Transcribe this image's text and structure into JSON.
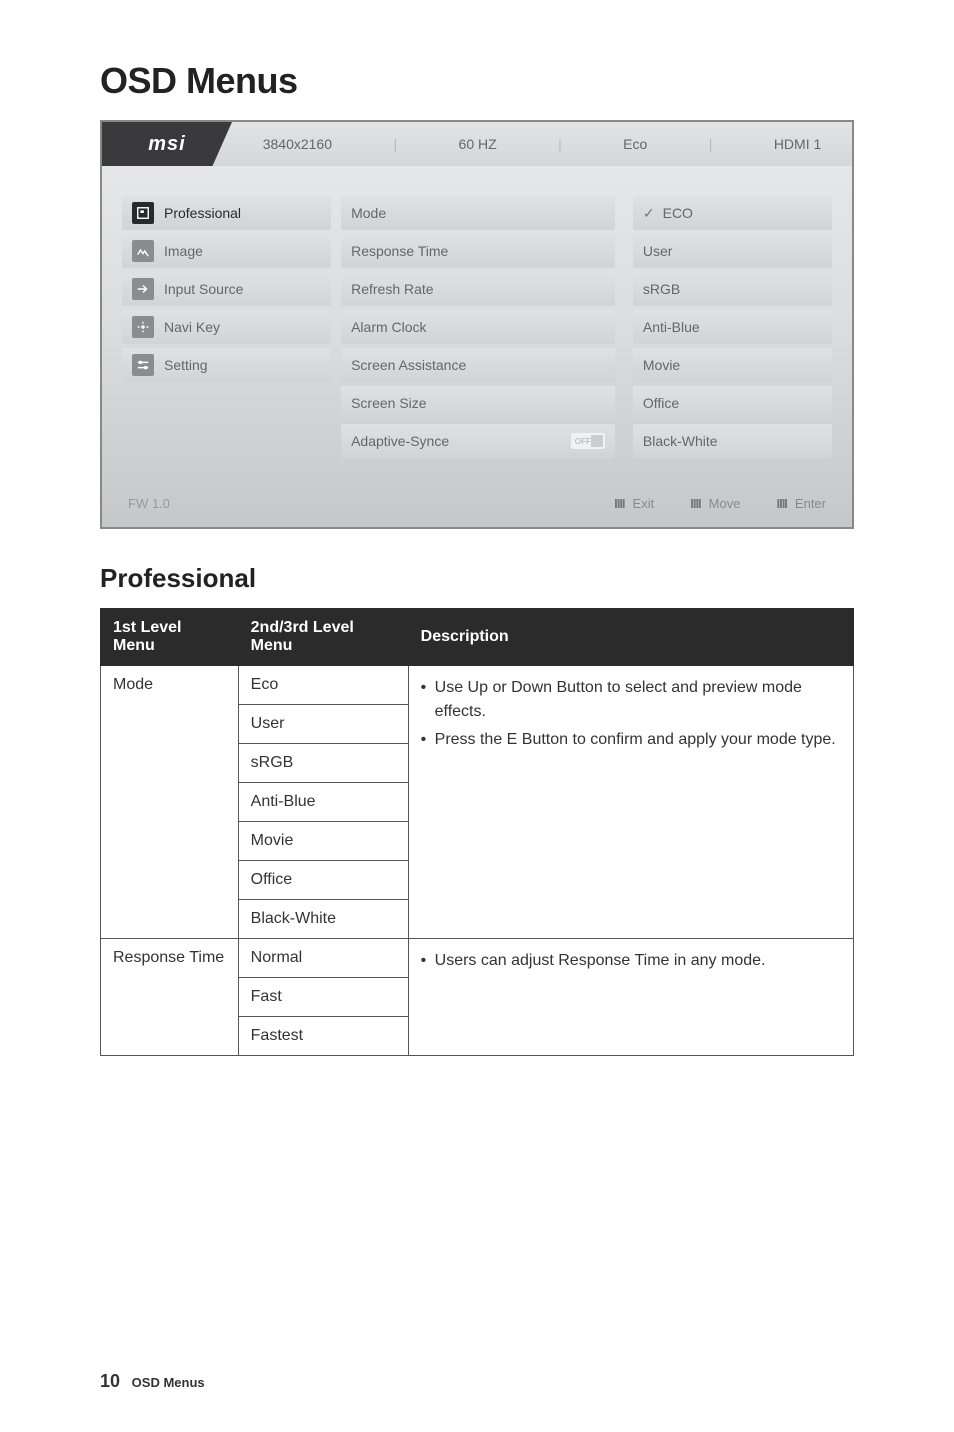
{
  "page": {
    "title": "OSD Menus",
    "section_heading": "Professional",
    "footer_page_number": "10",
    "footer_title": "OSD Menus"
  },
  "osd": {
    "brand": "msi",
    "status": {
      "resolution": "3840x2160",
      "refresh": "60 HZ",
      "mode": "Eco",
      "input": "HDMI 1"
    },
    "col1": [
      {
        "label": "Professional",
        "icon": "professional-icon",
        "selected": true
      },
      {
        "label": "Image",
        "icon": "image-icon"
      },
      {
        "label": "Input Source",
        "icon": "input-source-icon"
      },
      {
        "label": "Navi Key",
        "icon": "navi-key-icon"
      },
      {
        "label": "Setting",
        "icon": "setting-icon"
      }
    ],
    "col2": [
      {
        "label": "Mode"
      },
      {
        "label": "Response Time"
      },
      {
        "label": "Refresh Rate"
      },
      {
        "label": "Alarm Clock"
      },
      {
        "label": "Screen Assistance"
      },
      {
        "label": "Screen Size"
      },
      {
        "label": "Adaptive-Synce",
        "toggle": "OFF"
      }
    ],
    "col3": [
      {
        "label": "ECO",
        "checked": true
      },
      {
        "label": "User"
      },
      {
        "label": "sRGB"
      },
      {
        "label": "Anti-Blue"
      },
      {
        "label": "Movie"
      },
      {
        "label": "Office"
      },
      {
        "label": "Black-White"
      }
    ],
    "bottom": {
      "fw": "FW 1.0",
      "hints": [
        {
          "bars": "IIII",
          "label": "Exit"
        },
        {
          "bars": "IIII",
          "label": "Move"
        },
        {
          "bars": "IIII",
          "label": "Enter"
        }
      ]
    }
  },
  "table": {
    "headers": [
      "1st Level Menu",
      "2nd/3rd Level Menu",
      "Description"
    ],
    "groups": [
      {
        "level1": "Mode",
        "level2": [
          "Eco",
          "User",
          "sRGB",
          "Anti-Blue",
          "Movie",
          "Office",
          "Black-White"
        ],
        "desc": [
          "Use Up or Down Button to select and preview mode effects.",
          "Press the E Button to confirm and apply your mode type."
        ]
      },
      {
        "level1": "Response Time",
        "level2": [
          "Normal",
          "Fast",
          "Fastest"
        ],
        "desc": [
          "Users can adjust Response Time in any mode."
        ]
      }
    ]
  }
}
